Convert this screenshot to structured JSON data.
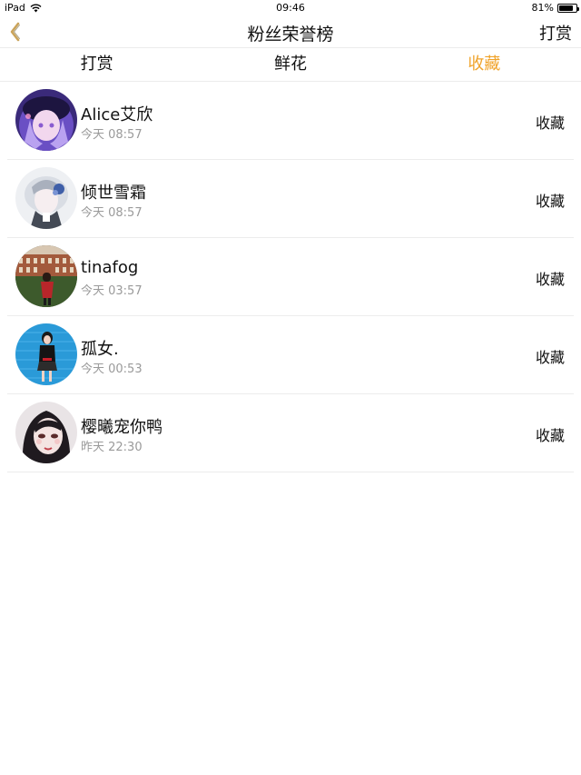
{
  "status": {
    "device": "iPad",
    "time": "09:46",
    "battery": "81%",
    "battery_level": 0.81
  },
  "nav": {
    "title": "粉丝荣誉榜",
    "right_label": "打赏",
    "back_icon": "chevron-left-icon",
    "accent": "#f0a32a"
  },
  "tabs": [
    {
      "label": "打赏",
      "active": false
    },
    {
      "label": "鲜花",
      "active": false
    },
    {
      "label": "收藏",
      "active": true
    }
  ],
  "fans": [
    {
      "name": "Alice艾欣",
      "time": "今天 08:57",
      "action": "收藏"
    },
    {
      "name": "倾世雪霜",
      "time": "今天 08:57",
      "action": "收藏"
    },
    {
      "name": "tinafog",
      "time": "今天 03:57",
      "action": "收藏"
    },
    {
      "name": "孤女.",
      "time": "今天 00:53",
      "action": "收藏"
    },
    {
      "name": "樱曦宠你鸭",
      "time": "昨天 22:30",
      "action": "收藏"
    }
  ]
}
